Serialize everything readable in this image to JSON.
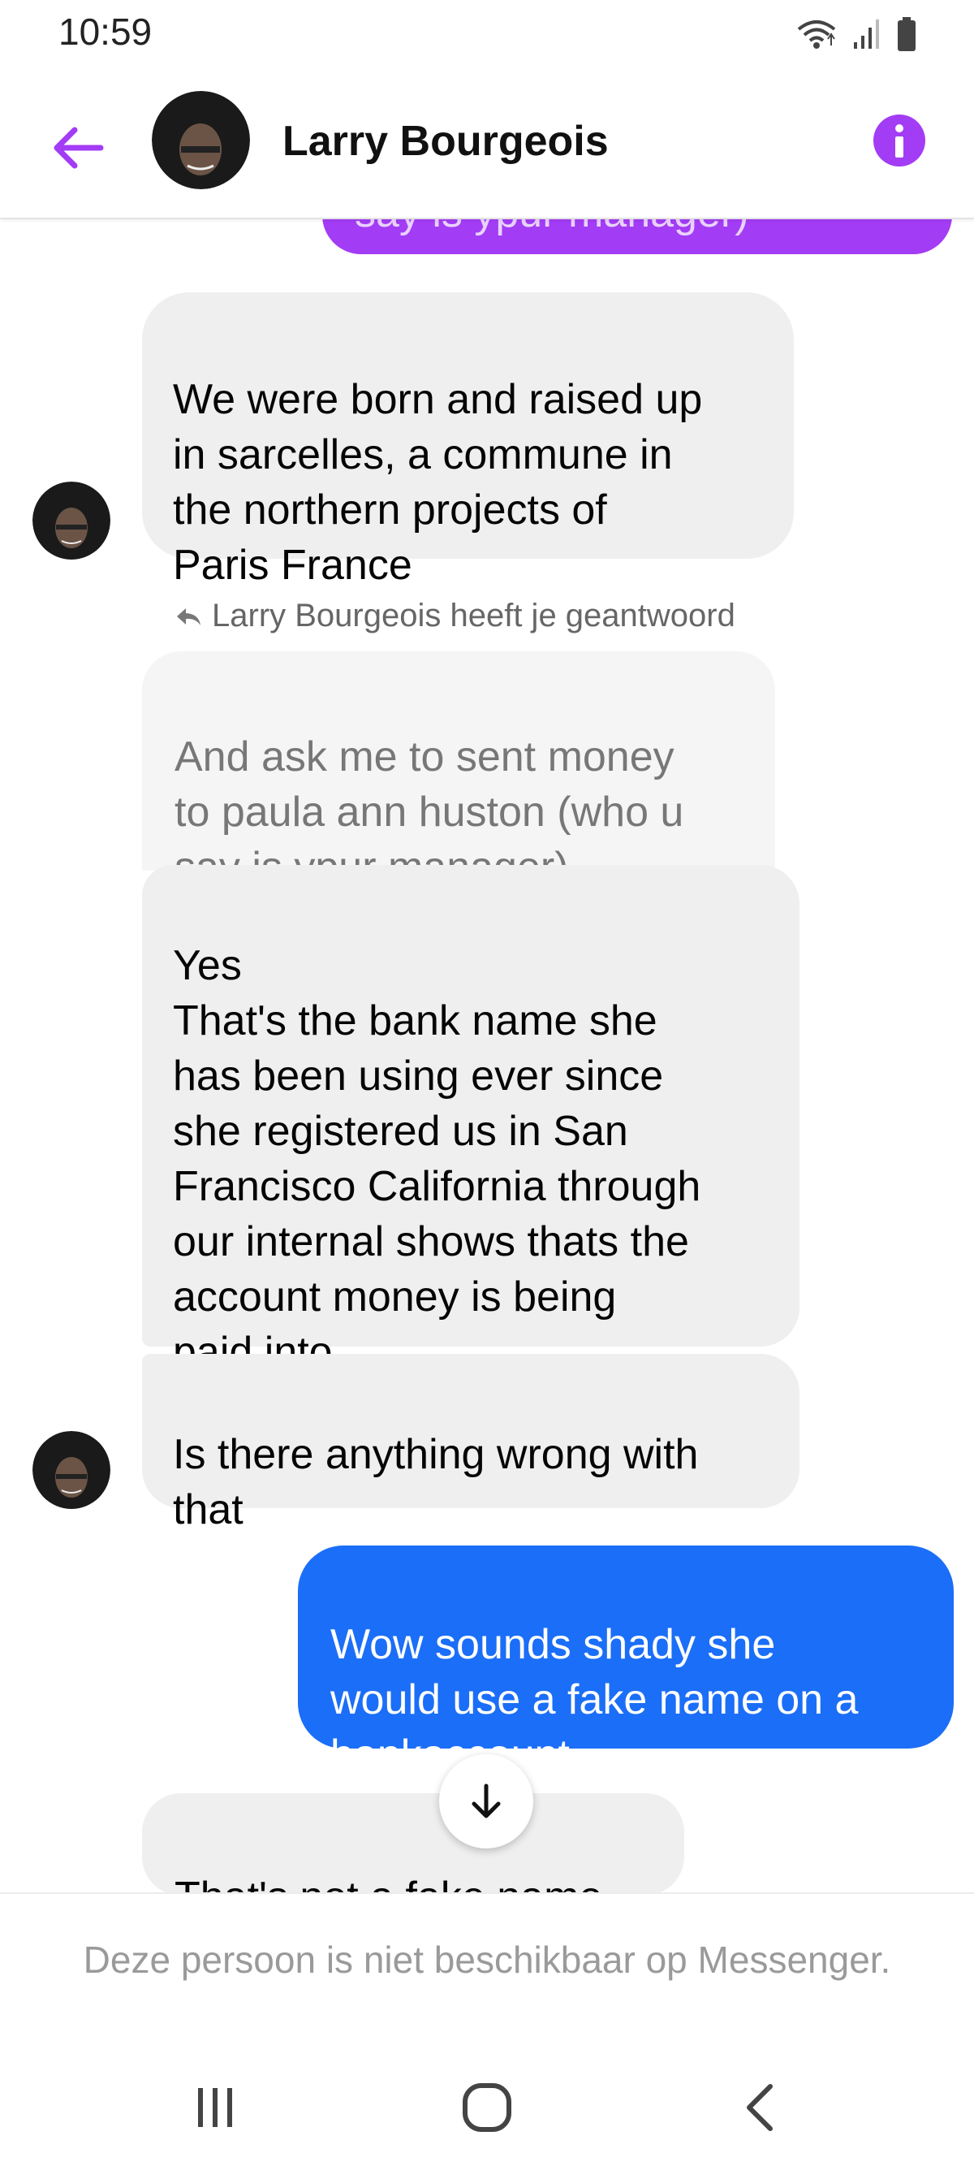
{
  "status_bar": {
    "time": "10:59",
    "icons": [
      "wifi-icon",
      "signal-icon",
      "battery-icon"
    ]
  },
  "header": {
    "contact_name": "Larry Bourgeois",
    "back_icon": "arrow-left-icon",
    "info_icon": "info-icon",
    "accent_color": "#a33cf5"
  },
  "conversation": {
    "partial_outgoing": "say is ypur manager)",
    "messages": [
      {
        "sender": "contact",
        "text": "We were born and raised up\nin sarcelles, a commune in\nthe northern projects of\nParis France"
      },
      {
        "sender": "contact",
        "reply_note": "Larry Bourgeois  heeft je geantwoord",
        "quoted_text": "And ask me to sent money\nto paula ann huston (who u\nsay is ypur manager)",
        "text": "Yes\n That's the bank name she\nhas been using ever since\nshe registered us in San\nFrancisco California through\nour internal shows thats the\naccount money is being\npaid into"
      },
      {
        "sender": "contact",
        "text": "Is there anything wrong with\nthat"
      },
      {
        "sender": "me",
        "text": "Wow sounds shady she\nwould use a fake name on a\nbankaccount"
      },
      {
        "sender": "contact",
        "text": "That's not a fake name"
      }
    ],
    "scroll_down_icon": "arrow-down-icon"
  },
  "notice": {
    "text": "Deze persoon is niet beschikbaar op Messenger."
  },
  "navbar": {
    "icons": [
      "recent-apps-icon",
      "home-icon",
      "back-icon"
    ]
  },
  "colors": {
    "outgoing_bubble": "#1b6ef7",
    "incoming_bubble": "#efefef",
    "purple_bubble": "#a33cf5"
  }
}
